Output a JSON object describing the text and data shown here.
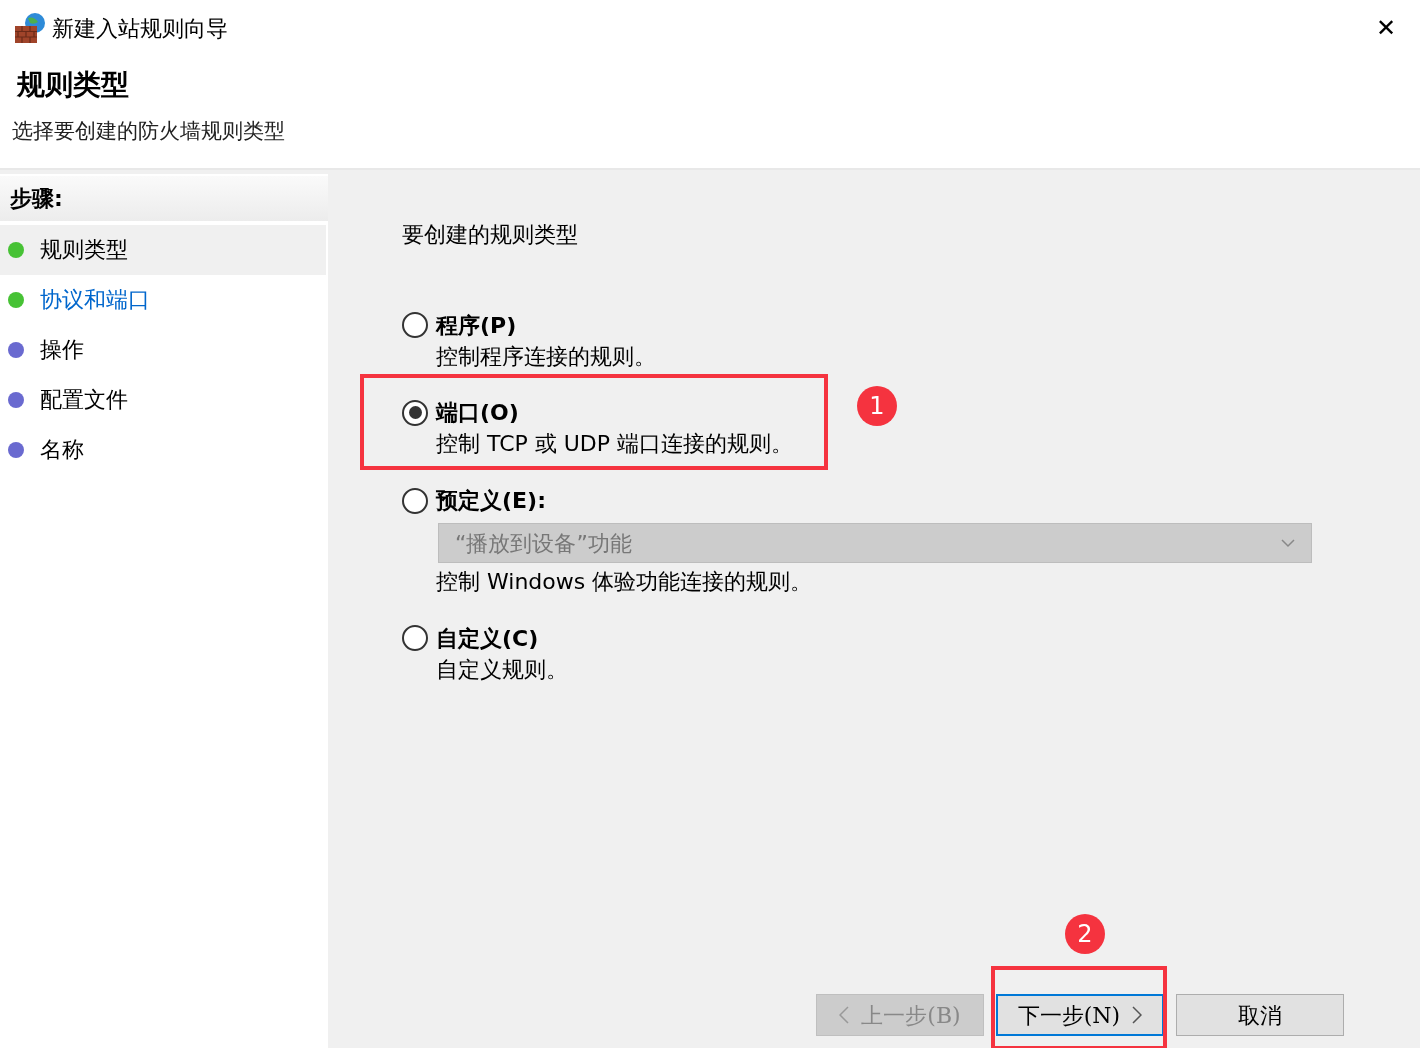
{
  "window": {
    "title": "新建入站规则向导",
    "close": "✕"
  },
  "header": {
    "title": "规则类型",
    "subtitle": "选择要创建的防火墙规则类型"
  },
  "sidebar": {
    "heading": "步骤:",
    "items": [
      {
        "label": "规则类型",
        "color": "#47c235",
        "selected": true,
        "link": false
      },
      {
        "label": "协议和端口",
        "color": "#47c235",
        "selected": false,
        "link": true
      },
      {
        "label": "操作",
        "color": "#6a6ad0",
        "selected": false,
        "link": false
      },
      {
        "label": "配置文件",
        "color": "#6a6ad0",
        "selected": false,
        "link": false
      },
      {
        "label": "名称",
        "color": "#6a6ad0",
        "selected": false,
        "link": false
      }
    ]
  },
  "main": {
    "prompt": "要创建的规则类型",
    "options": [
      {
        "kind": "plain",
        "title": "程序(P)",
        "description": "控制程序连接的规则。",
        "selected": false
      },
      {
        "kind": "plain",
        "title": "端口(O)",
        "description": "控制 TCP 或 UDP 端口连接的规则。",
        "selected": true,
        "annotation": "1"
      },
      {
        "kind": "dropdown",
        "title": "预定义(E):",
        "dropdown": {
          "value": "“播放到设备”功能",
          "disabled": true
        },
        "description": "控制 Windows 体验功能连接的规则。",
        "selected": false
      },
      {
        "kind": "plain",
        "title": "自定义(C)",
        "description": "自定义规则。",
        "selected": false
      }
    ]
  },
  "buttons": [
    {
      "kind": "back",
      "label": "上一步(B)",
      "disabled": true,
      "focused": false
    },
    {
      "kind": "next",
      "label": "下一步(N)",
      "disabled": false,
      "focused": true,
      "annotation": "2"
    },
    {
      "kind": "cancel",
      "label": "取消",
      "disabled": false,
      "focused": false
    }
  ]
}
